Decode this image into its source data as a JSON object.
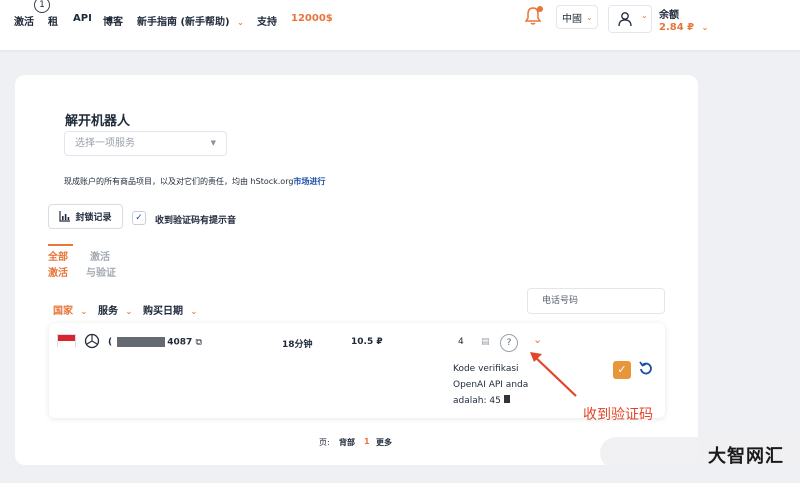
{
  "nav": {
    "items": [
      "激活",
      "租",
      "API",
      "博客",
      "新手指南 (新手帮助)",
      "支持",
      "12000$"
    ],
    "badge": "1"
  },
  "header": {
    "language": "中國",
    "balance_label": "余额",
    "balance_value": "2.84 ₽"
  },
  "panel": {
    "title": "解开机器人",
    "service_placeholder": "选择一项服务",
    "notice_prefix": "现成账户的所有商品项目，以及对它们的责任，均由 hStock.org",
    "notice_link": "市场进行",
    "lock_button": "封锁记录",
    "sound_checkbox_label": "收到验证码有提示音"
  },
  "tabs": [
    {
      "line1": "全部",
      "line2": "激活",
      "active": true
    },
    {
      "line1": "激活",
      "line2": "与验证",
      "active": false
    }
  ],
  "filters": [
    "国家",
    "服务",
    "购买日期"
  ],
  "phone_column": "电话号码",
  "order": {
    "number_prefix": "(",
    "number_suffix": "4087",
    "duration": "18分钟",
    "price": "10.5 ₽",
    "count": "4",
    "sms_lines": [
      "Kode verifikasi",
      "OpenAI API anda",
      "adalah: 45"
    ]
  },
  "annotation": "收到验证码",
  "pagination": {
    "label": "页:",
    "back": "背部",
    "current": "1",
    "more": "更多"
  },
  "watermark": "大智网汇",
  "colors": {
    "accent": "#e8763a",
    "link": "#1d4fa8",
    "annotation": "#e2452a"
  }
}
